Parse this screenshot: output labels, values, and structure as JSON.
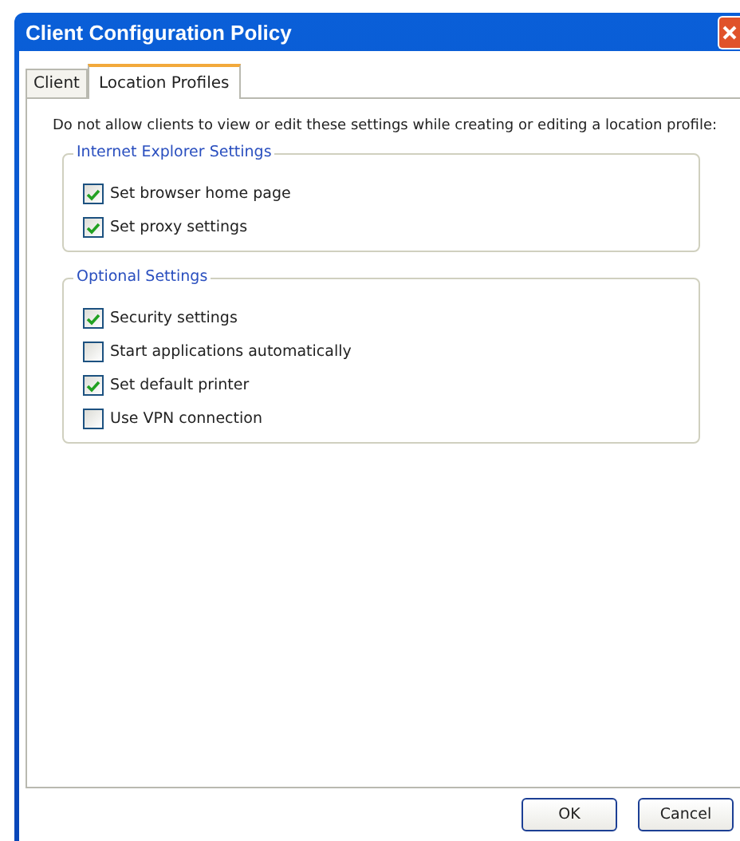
{
  "window": {
    "title": "Client Configuration Policy"
  },
  "tabs": [
    {
      "label": "Client",
      "selected": false
    },
    {
      "label": "Location Profiles",
      "selected": true
    }
  ],
  "intro": "Do not allow clients to view or edit these settings while creating or editing a location profile:",
  "groups": [
    {
      "title": "Internet Explorer Settings",
      "items": [
        {
          "label": "Set browser home page",
          "checked": true
        },
        {
          "label": "Set proxy settings",
          "checked": true
        }
      ]
    },
    {
      "title": "Optional Settings",
      "items": [
        {
          "label": "Security settings",
          "checked": true
        },
        {
          "label": "Start applications automatically",
          "checked": false
        },
        {
          "label": "Set default printer",
          "checked": true
        },
        {
          "label": "Use VPN connection",
          "checked": false
        }
      ]
    }
  ],
  "buttons": [
    "OK",
    "Cancel"
  ]
}
